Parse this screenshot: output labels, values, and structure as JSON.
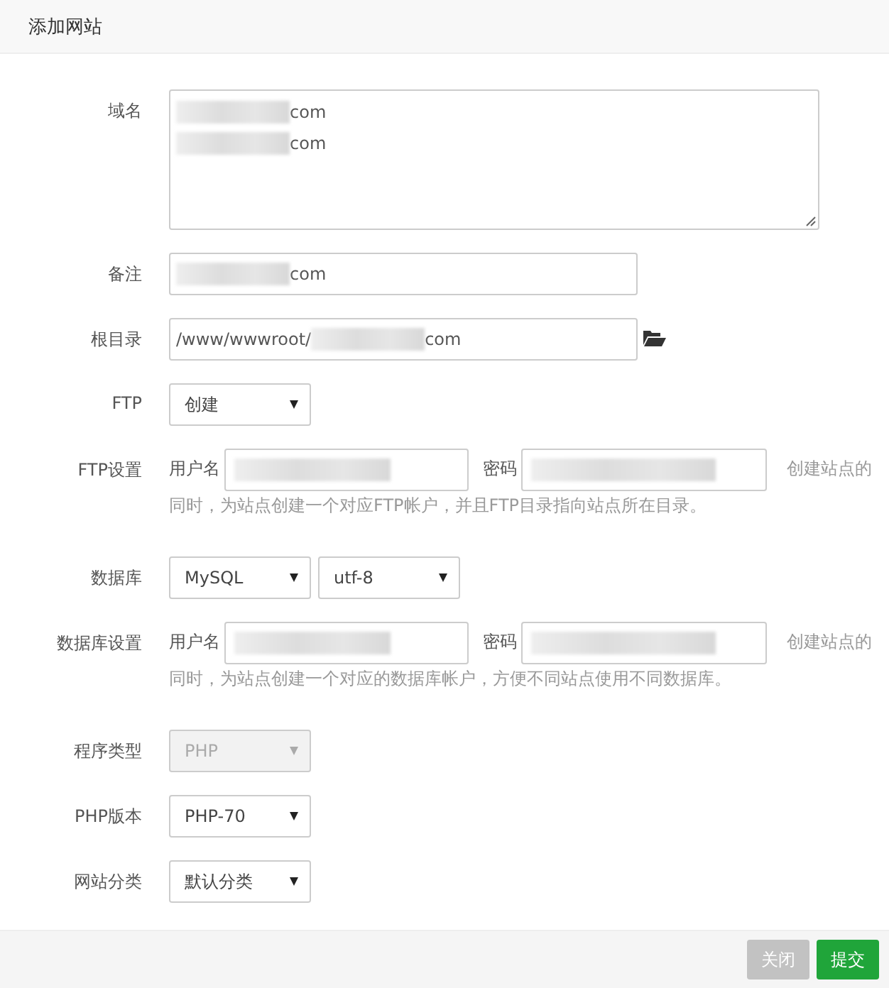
{
  "dialog": {
    "title": "添加网站"
  },
  "rows": [
    {
      "kind": "textarea",
      "label": "域名",
      "lines": [
        [
          {
            "kind": "blur"
          },
          {
            "kind": "text",
            "text": "com"
          }
        ],
        [
          {
            "kind": "blur"
          },
          {
            "kind": "text",
            "text": "com"
          }
        ]
      ]
    },
    {
      "kind": "input",
      "label": "备注",
      "value": [
        {
          "kind": "blur"
        },
        {
          "kind": "text",
          "text": "com"
        }
      ]
    },
    {
      "kind": "input",
      "label": "根目录",
      "value": [
        {
          "kind": "text",
          "text": "/www/wwwroot/"
        },
        {
          "kind": "blur"
        },
        {
          "kind": "text",
          "text": "com"
        }
      ],
      "folder_button": true
    },
    {
      "kind": "selects",
      "label": "FTP",
      "selects": [
        {
          "value": "创建",
          "disabled": false
        }
      ]
    },
    {
      "kind": "credentials",
      "label": "FTP设置",
      "user_label": "用户名",
      "password_label": "密码",
      "hint_lines": [
        "创建站点的",
        "同时，为站点创建一个对应FTP帐户，并且FTP目录指向站点所在目录。"
      ]
    },
    {
      "kind": "selects",
      "label": "数据库",
      "selects": [
        {
          "value": "MySQL",
          "disabled": false
        },
        {
          "value": "utf-8",
          "disabled": false
        }
      ]
    },
    {
      "kind": "credentials",
      "label": "数据库设置",
      "user_label": "用户名",
      "password_label": "密码",
      "hint_lines": [
        "创建站点的",
        "同时，为站点创建一个对应的数据库帐户，方便不同站点使用不同数据库。"
      ]
    },
    {
      "kind": "selects",
      "label": "程序类型",
      "selects": [
        {
          "value": "PHP",
          "disabled": true
        }
      ]
    },
    {
      "kind": "selects",
      "label": "PHP版本",
      "selects": [
        {
          "value": "PHP-70",
          "disabled": false
        }
      ]
    },
    {
      "kind": "selects",
      "label": "网站分类",
      "selects": [
        {
          "value": "默认分类",
          "disabled": false
        }
      ]
    }
  ],
  "buttons": [
    {
      "label": "关闭",
      "kind": "secondary"
    },
    {
      "label": "提交",
      "kind": "primary"
    }
  ]
}
